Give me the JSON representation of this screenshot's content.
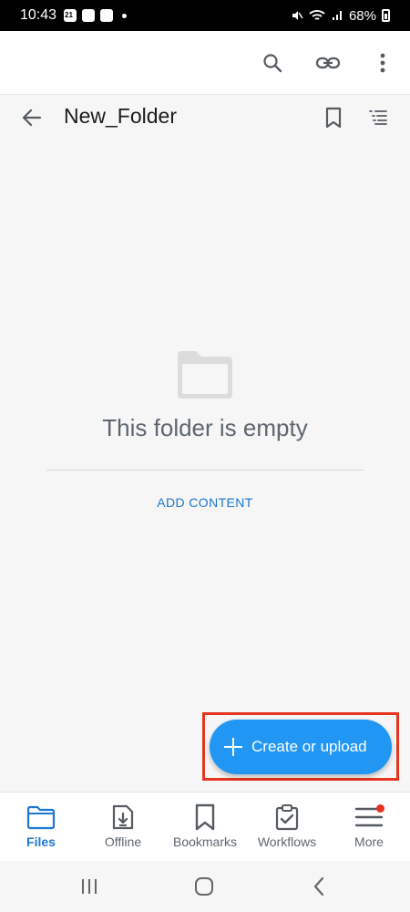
{
  "status_bar": {
    "time": "10:43",
    "calendar_day": "21",
    "battery": "68%"
  },
  "appbar": {
    "icons": [
      "search-icon",
      "link-icon",
      "more-vert-icon"
    ]
  },
  "folder": {
    "title": "New_Folder"
  },
  "empty_state": {
    "message": "This folder is empty",
    "action_label": "ADD CONTENT"
  },
  "fab": {
    "label": "Create or upload"
  },
  "bottom_nav": {
    "items": [
      {
        "label": "Files",
        "icon": "folder-icon",
        "active": true
      },
      {
        "label": "Offline",
        "icon": "offline-download-icon",
        "active": false
      },
      {
        "label": "Bookmarks",
        "icon": "bookmark-icon",
        "active": false
      },
      {
        "label": "Workflows",
        "icon": "clipboard-check-icon",
        "active": false
      },
      {
        "label": "More",
        "icon": "menu-icon",
        "active": false,
        "badge": true
      }
    ]
  },
  "colors": {
    "accent": "#1b77d2",
    "fab": "#2196f3",
    "highlight": "#e5341f"
  }
}
